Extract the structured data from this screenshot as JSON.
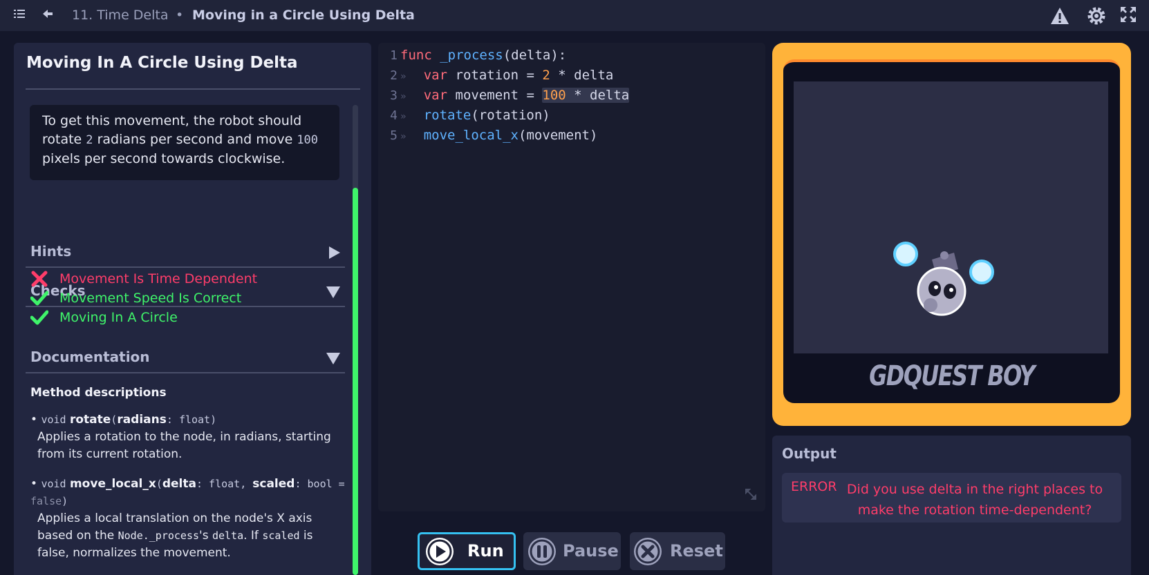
{
  "topbar": {
    "chapter": "11. Time Delta",
    "separator": "•",
    "lesson": "Moving in a Circle Using Delta",
    "icons": [
      "menu-icon",
      "back-icon",
      "warning-icon",
      "gear-icon",
      "fullscreen-icon"
    ]
  },
  "lesson": {
    "title": "Moving In A Circle Using Delta",
    "goal": {
      "pre": "To get this movement, the robot should rotate ",
      "n1": "2",
      "mid": " radians per second and move ",
      "n2": "100",
      "post": " pixels per second towards clockwise."
    },
    "hints_label": "Hints",
    "checks_label": "Checks",
    "checks": [
      {
        "label": "Movement Is Time Dependent",
        "status": "fail"
      },
      {
        "label": "Movement Speed Is Correct",
        "status": "pass"
      },
      {
        "label": "Moving In A Circle",
        "status": "pass"
      }
    ],
    "documentation_label": "Documentation",
    "method_descriptions_label": "Method descriptions",
    "methods": [
      {
        "bullet": "•",
        "ret": "void",
        "name": "rotate",
        "params": [
          {
            "name": "radians",
            "type": "float"
          }
        ],
        "desc": "Applies a rotation to the node, in radians, starting from its current rotation."
      },
      {
        "bullet": "•",
        "ret": "void",
        "name": "move_local_x",
        "p1_name": "delta",
        "p1_type": "float",
        "p2_name": "scaled",
        "p2_type": "bool",
        "p2_default": "false",
        "desc_1": "Applies a local translation on the node's X axis based on the ",
        "desc_code1": "Node._process",
        "desc_2": "'s ",
        "desc_code2": "delta",
        "desc_3": ". If ",
        "desc_code3": "scaled",
        "desc_4": " is false, normalizes the movement."
      }
    ]
  },
  "editor": {
    "line_numbers": [
      "1",
      "2",
      "3",
      "4",
      "5"
    ],
    "lines": [
      {
        "kw": "func",
        "fn": "_process",
        "rest": "(delta):"
      },
      {
        "kw": "var",
        "name": "rotation",
        "eq": "=",
        "num": "2",
        "rest": "* delta"
      },
      {
        "kw": "var",
        "name": "movement",
        "eq": "=",
        "num": "100",
        "rest": "* delta"
      },
      {
        "fn": "rotate",
        "rest": "(rotation)"
      },
      {
        "fn": "move_local_x",
        "rest": "(movement)"
      }
    ]
  },
  "controls": {
    "run_label": "Run",
    "pause_label": "Pause",
    "reset_label": "Reset"
  },
  "game": {
    "brand": "GDQUEST BOY"
  },
  "output": {
    "title": "Output",
    "tag": "ERROR",
    "message": "Did you use delta in the right places to make the rotation time-dependent?"
  },
  "colors": {
    "pass": "#3ff46a",
    "fail": "#ff3d6a",
    "accent_run": "#35c1f1",
    "game_frame": "#ffb33a"
  }
}
